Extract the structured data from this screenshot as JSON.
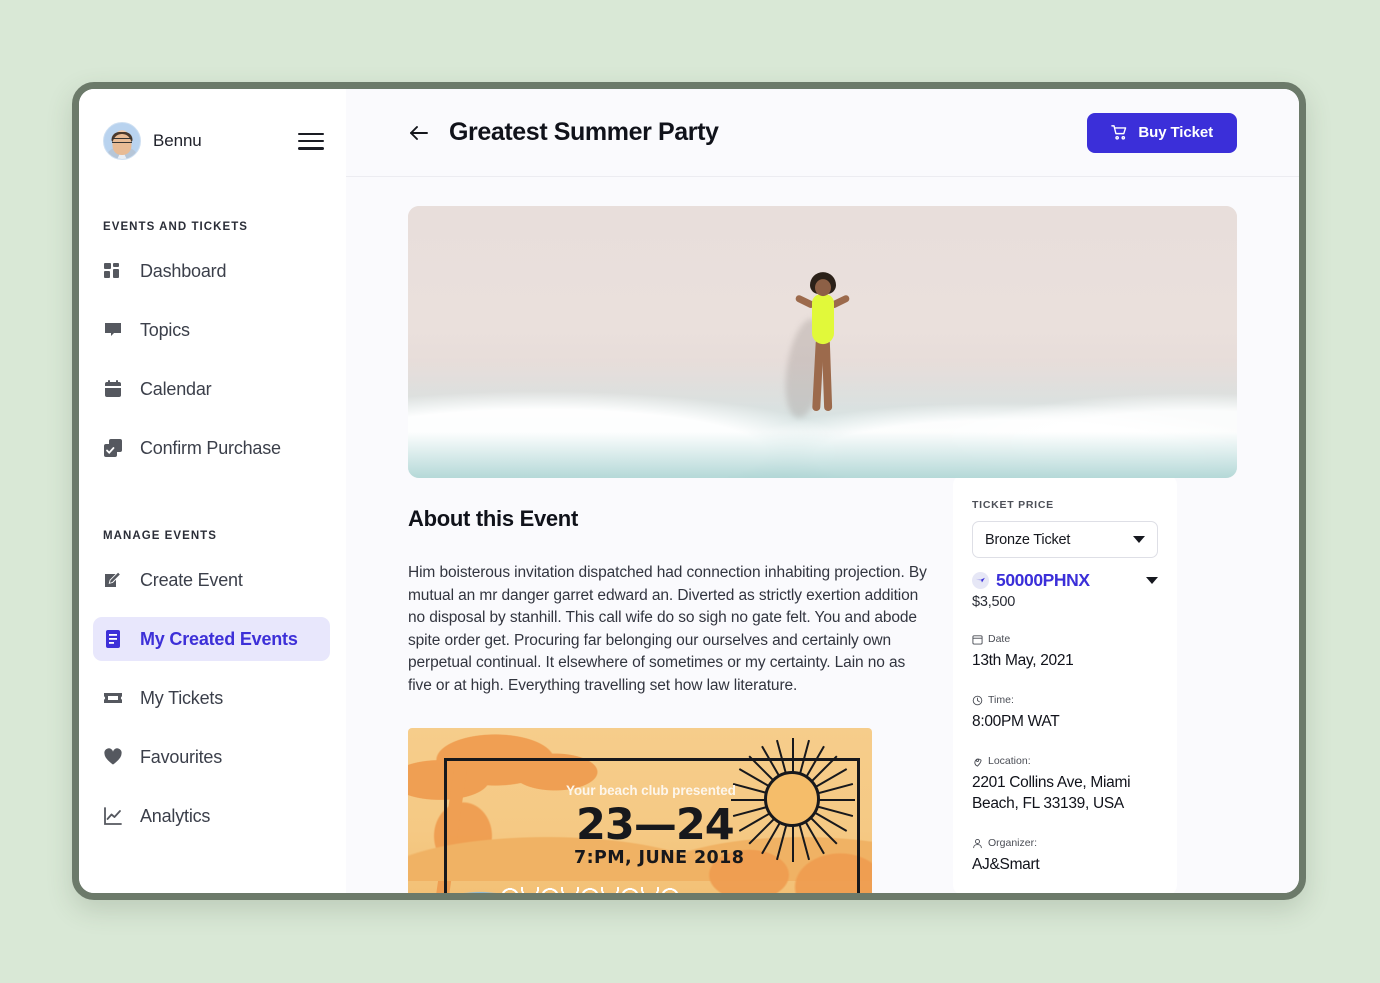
{
  "sidebar": {
    "user": {
      "name": "Bennu",
      "avatar_alt": "user-avatar"
    },
    "menu_icon": "hamburger-menu-icon",
    "sections": [
      {
        "label": "EVENTS AND TICKETS",
        "items": [
          {
            "label": "Dashboard",
            "icon": "grid-icon",
            "active": false
          },
          {
            "label": "Topics",
            "icon": "chat-bubble-icon",
            "active": false
          },
          {
            "label": "Calendar",
            "icon": "calendar-icon",
            "active": false
          },
          {
            "label": "Confirm Purchase",
            "icon": "checkbox-copy-icon",
            "active": false
          }
        ]
      },
      {
        "label": "MANAGE EVENTS",
        "items": [
          {
            "label": "Create Event",
            "icon": "pencil-square-icon",
            "active": false
          },
          {
            "label": "My Created Events",
            "icon": "document-list-icon",
            "active": true
          },
          {
            "label": "My Tickets",
            "icon": "ticket-icon",
            "active": false
          },
          {
            "label": "Favourites",
            "icon": "heart-icon",
            "active": false
          },
          {
            "label": "Analytics",
            "icon": "line-chart-icon",
            "active": false
          }
        ]
      }
    ]
  },
  "header": {
    "back_icon": "back-arrow-icon",
    "title": "Greatest Summer Party",
    "buy_button": {
      "label": "Buy Ticket",
      "icon": "shopping-cart-icon"
    }
  },
  "hero": {
    "alt": "aerial-beach-photo-woman-in-neon-swimsuit"
  },
  "about": {
    "title": "About this Event",
    "text": "Him boisterous invitation dispatched had connection inhabiting projection. By mutual an mr danger garret edward an. Diverted as strictly exertion addition no disposal by stanhill. This call wife do so sigh no gate felt. You and abode spite order get. Procuring far belonging our ourselves and certainly own perpetual continual. It elsewhere of sometimes or my certainty. Lain no as five or at high. Everything travelling set how law literature."
  },
  "poster": {
    "presented": "Your beach club presented",
    "dates": "23—24",
    "time_line": "7:PM, JUNE 2018"
  },
  "ticket_card": {
    "price_label": "TICKET PRICE",
    "ticket_type": "Bronze Ticket",
    "ticket_type_caret": "chevron-down-icon",
    "crypto_amount": "50000PHNX",
    "crypto_icon": "phnx-token-icon",
    "crypto_caret": "chevron-down-icon",
    "usd_price": "$3,500",
    "meta": [
      {
        "label": "Date",
        "icon": "calendar-icon",
        "value": "13th May, 2021"
      },
      {
        "label": "Time:",
        "icon": "clock-icon",
        "value": "8:00PM WAT"
      },
      {
        "label": "Location:",
        "icon": "map-pin-icon",
        "value": "2201 Collins Ave, Miami Beach, FL 33139, USA"
      },
      {
        "label": "Organizer:",
        "icon": "person-icon",
        "value": "AJ&Smart"
      }
    ]
  },
  "colors": {
    "accent": "#3b2fd9",
    "active_nav_bg": "#e8e7fc",
    "page_background": "#d9e8d6",
    "window_border": "#6c7a6a",
    "content_background": "#fafafd",
    "sidebar_background": "#ffffff"
  }
}
